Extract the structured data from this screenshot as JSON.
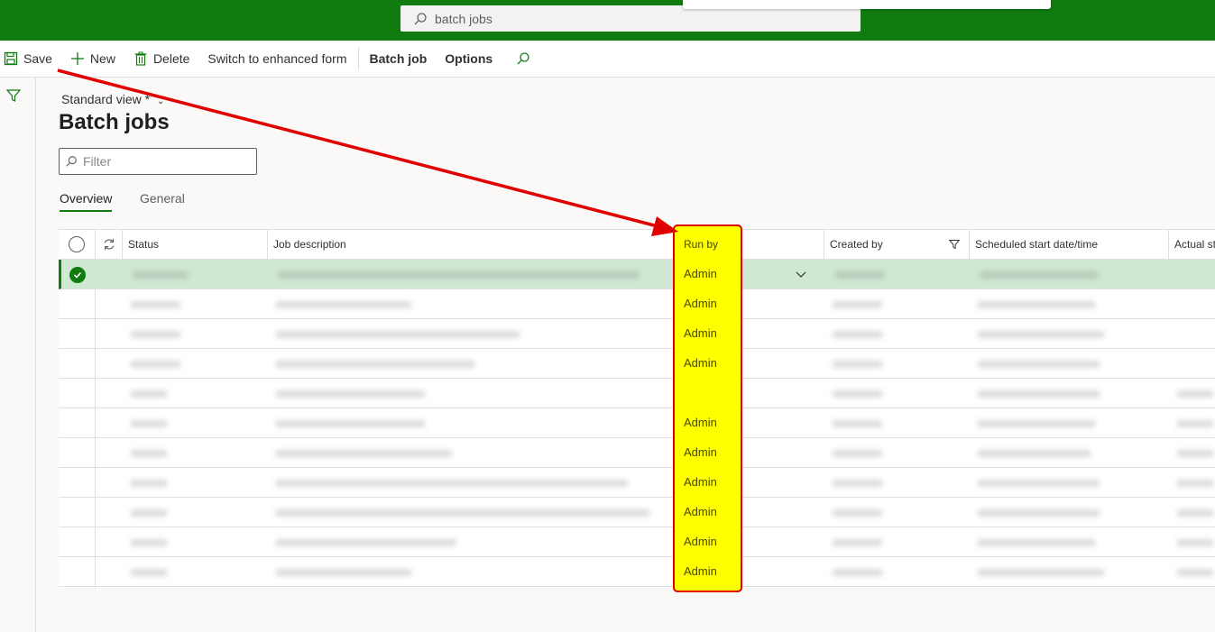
{
  "topbar": {
    "search_text": "batch jobs"
  },
  "actions": {
    "save": "Save",
    "new": "New",
    "delete": "Delete",
    "switch": "Switch to enhanced form",
    "batch_job": "Batch job",
    "options": "Options"
  },
  "page": {
    "view": "Standard view *",
    "title": "Batch jobs",
    "filter_placeholder": "Filter"
  },
  "tabs": [
    "Overview",
    "General"
  ],
  "grid": {
    "columns": {
      "status": "Status",
      "job_description": "Job description",
      "run_by": "Run by",
      "created_by": "Created by",
      "scheduled": "Scheduled start date/time",
      "actual": "Actual st"
    },
    "rows": [
      {
        "run_by": "Admin",
        "selected": true
      },
      {
        "run_by": "Admin"
      },
      {
        "run_by": "Admin"
      },
      {
        "run_by": "Admin"
      },
      {
        "run_by": ""
      },
      {
        "run_by": "Admin"
      },
      {
        "run_by": "Admin"
      },
      {
        "run_by": "Admin"
      },
      {
        "run_by": "Admin"
      },
      {
        "run_by": "Admin"
      },
      {
        "run_by": "Admin"
      }
    ]
  },
  "colors": {
    "brand": "#107c10",
    "highlight": "#ffff00",
    "annotation": "#e00000"
  }
}
